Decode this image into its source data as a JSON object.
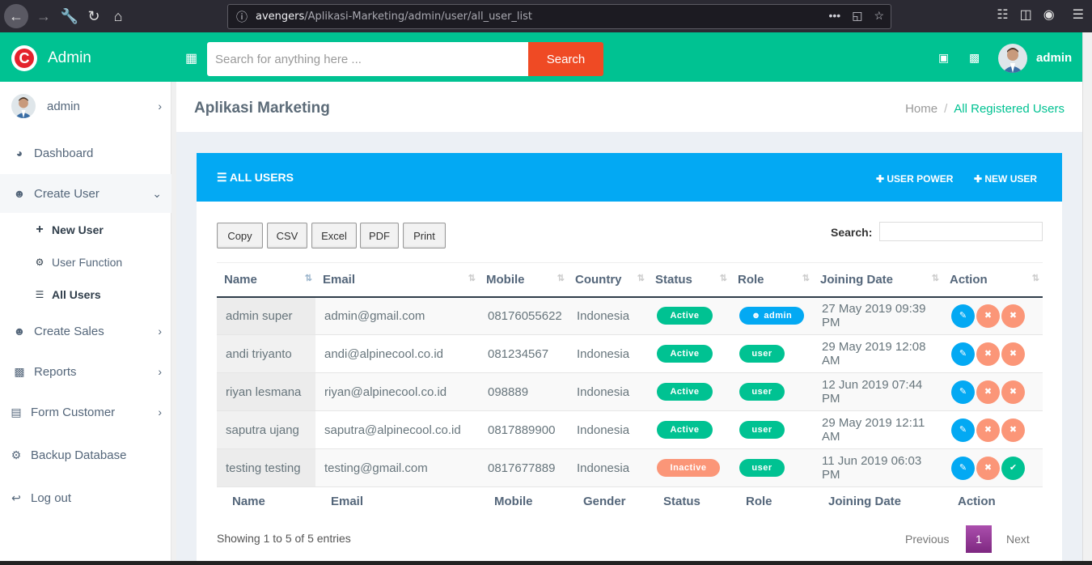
{
  "browser": {
    "url_host": "avengers",
    "url_path": "/Aplikasi-Marketing/admin/user/all_user_list",
    "dots": "•••"
  },
  "header": {
    "brand_letter": "C",
    "brand_name": "Admin",
    "search_placeholder": "Search for anything here ...",
    "search_button": "Search",
    "username": "admin"
  },
  "sidebar": {
    "profile_name": "admin",
    "items": [
      {
        "label": "Dashboard",
        "icon": "dashboard-icon"
      },
      {
        "label": "Create User",
        "icon": "user-icon"
      },
      {
        "label": "Create Sales",
        "icon": "user-icon"
      },
      {
        "label": "Reports",
        "icon": "bar-chart-icon"
      },
      {
        "label": "Form Customer",
        "icon": "document-icon"
      },
      {
        "label": "Backup Database",
        "icon": "gear-icon"
      },
      {
        "label": "Log out",
        "icon": "logout-icon"
      }
    ],
    "sub_items": [
      {
        "label": "New User",
        "icon": "plus-icon"
      },
      {
        "label": "User Function",
        "icon": "gear-icon"
      },
      {
        "label": "All Users",
        "icon": "list-icon"
      }
    ]
  },
  "page": {
    "title": "Aplikasi Marketing",
    "breadcrumb_home": "Home",
    "breadcrumb_sep": "/",
    "breadcrumb_current": "All Registered Users"
  },
  "card": {
    "title": "ALL USERS",
    "user_power": "USER POWER",
    "new_user": "NEW USER"
  },
  "toolbar": {
    "copy": "Copy",
    "csv": "CSV",
    "excel": "Excel",
    "pdf": "PDF",
    "print": "Print",
    "search_label": "Search:"
  },
  "table": {
    "headers": [
      "Name",
      "Email",
      "Mobile",
      "Country",
      "Status",
      "Role",
      "Joining Date",
      "Action"
    ],
    "footers": [
      "Name",
      "Email",
      "Mobile",
      "Gender",
      "Status",
      "Role",
      "Joining Date",
      "Action"
    ],
    "rows": [
      {
        "name": "admin super",
        "email": "admin@gmail.com",
        "mobile": "08176055622",
        "country": "Indonesia",
        "status": "Active",
        "role": "admin",
        "joined": "27 May 2019 09:39 PM"
      },
      {
        "name": "andi triyanto",
        "email": "andi@alpinecool.co.id",
        "mobile": "081234567",
        "country": "Indonesia",
        "status": "Active",
        "role": "user",
        "joined": "29 May 2019 12:08 AM"
      },
      {
        "name": "riyan lesmana",
        "email": "riyan@alpinecool.co.id",
        "mobile": "098889",
        "country": "Indonesia",
        "status": "Active",
        "role": "user",
        "joined": "12 Jun 2019 07:44 PM"
      },
      {
        "name": "saputra ujang",
        "email": "saputra@alpinecool.co.id",
        "mobile": "0817889900",
        "country": "Indonesia",
        "status": "Active",
        "role": "user",
        "joined": "29 May 2019 12:11 AM"
      },
      {
        "name": "testing testing",
        "email": "testing@gmail.com",
        "mobile": "0817677889",
        "country": "Indonesia",
        "status": "Inactive",
        "role": "user",
        "joined": "11 Jun 2019 06:03 PM"
      }
    ]
  },
  "pagination": {
    "info": "Showing 1 to 5 of 5 entries",
    "previous": "Previous",
    "page": "1",
    "next": "Next"
  },
  "colors": {
    "header": "#00c292",
    "card_header": "#03a9f3",
    "search_button": "#ef4a24",
    "active": "#00c292",
    "inactive": "#fb9678",
    "page_active": "#9b3d9d"
  }
}
